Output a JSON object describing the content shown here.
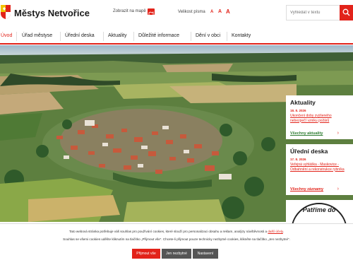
{
  "header": {
    "title": "Městys Netvořice",
    "map_link": "Zobrazit na mapě",
    "font_size_label": "Velikost písma",
    "font_a": [
      "A",
      "A",
      "A"
    ],
    "search_placeholder": "Vyhledat v textu"
  },
  "nav": {
    "items": [
      "Úvod",
      "Úřad městyse",
      "Úřední deska",
      "Aktuality",
      "Důležité informace",
      "Dění v obci",
      "Kontakty"
    ]
  },
  "aktuality": {
    "title": "Aktuality",
    "date": "18. 8. 2026",
    "text": "Ukončení doby zvýšeného nebezpečí vzniku požárů",
    "more": "Všechny aktuality"
  },
  "uredni_deska": {
    "title": "Úřední deska",
    "date": "17. 8. 2026",
    "text": "Veřejná vyhláška - Maskovice - Odbahnění a rekonstrukce rybníka",
    "more": "Všechny záznamy"
  },
  "badge": {
    "text": "Patříme do"
  },
  "cookie": {
    "line1": "Tato webová stránka potřebuje váš souhlas pro používání cookies, které slouží pro personalizaci obsahu a reklam, analýzy návštěvnosti a",
    "line1_link": "další účely",
    "line2": "Souhlas se všemi cookies udělíte kliknutím na tlačítko „Přijmout vše“. Chcete-li přijmout pouze technicky nezbytné cookies, klikněte na tlačítko „Jen nezbytné“.",
    "accept": "Přijmout vše",
    "necessary": "Jen nezbytné",
    "settings": "Nastavení"
  },
  "colors": {
    "accent": "#e2231a",
    "link_green": "#2e7d32"
  }
}
